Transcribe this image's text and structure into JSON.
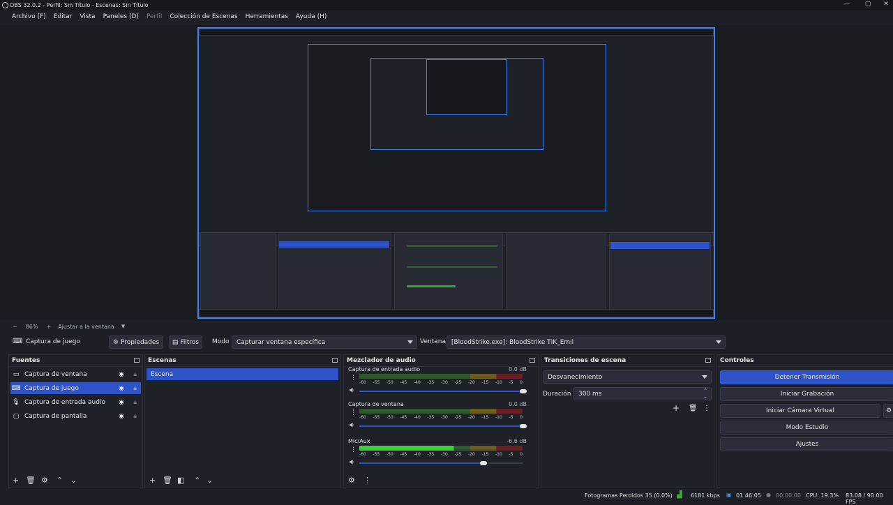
{
  "window": {
    "title": "OBS 32.0.2 - Perfil: Sin Título - Escenas: Sin Título"
  },
  "menu": [
    "Archivo (F)",
    "Editar",
    "Vista",
    "Paneles (D)",
    "Perfil",
    "Colección de Escenas",
    "Herramientas",
    "Ayuda (H)"
  ],
  "zoom": {
    "minus": "−",
    "level": "86%",
    "plus": "+",
    "fit": "Ajustar a la ventana"
  },
  "source_bar": {
    "source_name": "Captura de juego",
    "properties": "Propiedades",
    "filters": "Filtros",
    "mode_label": "Modo",
    "mode_value": "Capturar ventana específica",
    "window_label": "Ventana",
    "window_value": "[BloodStrike.exe]: BloodStrike TIK_Emil"
  },
  "sources": {
    "title": "Fuentes",
    "items": [
      {
        "label": "Captura de ventana",
        "icon": "window-icon"
      },
      {
        "label": "Captura de juego",
        "icon": "gamepad-icon",
        "selected": true
      },
      {
        "label": "Captura de entrada audio",
        "icon": "microphone-icon"
      },
      {
        "label": "Captura de pantalla",
        "icon": "monitor-icon"
      }
    ]
  },
  "scenes": {
    "title": "Escenas",
    "items": [
      {
        "label": "Escena",
        "selected": true
      }
    ]
  },
  "mixer": {
    "title": "Mezclador de audio",
    "channels": [
      {
        "name": "Captura de entrada audio",
        "db": "0.0 dB",
        "level": 0.0
      },
      {
        "name": "Captura de ventana",
        "db": "0.0 dB",
        "level": 0.0
      },
      {
        "name": "Mic/Aux",
        "db": "-6.6 dB",
        "level": 0.6
      }
    ],
    "scale": [
      "-60",
      "-55",
      "-50",
      "-45",
      "-40",
      "-35",
      "-30",
      "-25",
      "-20",
      "-15",
      "-10",
      "-5",
      "0"
    ]
  },
  "transitions": {
    "title": "Transiciones de escena",
    "type": "Desvanecimiento",
    "duration_label": "Duración",
    "duration_value": "300 ms"
  },
  "controls": {
    "title": "Controles",
    "buttons": [
      "Detener Transmisión",
      "Iniciar Grabación",
      "Iniciar Cámara Virtual",
      "Modo Estudio",
      "Ajustes"
    ]
  },
  "status": {
    "dropped": "Fotogramas Perdidos 35 (0.0%)",
    "bitrate": "6181 kbps",
    "stream_time": "01:46:05",
    "rec_time": "00:00:00",
    "cpu": "CPU: 19.3%",
    "fps": "83.08 / 90.00 FPS"
  },
  "colors": {
    "accent": "#2e52c7",
    "bg": "#1d1f26",
    "green": "#3aa63a"
  }
}
